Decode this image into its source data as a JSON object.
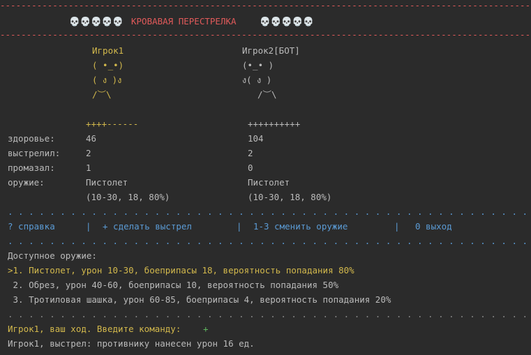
{
  "header": {
    "line_top": "------------------------------------------------------------------------------------------------------------------------",
    "skulls_left": "💀💀💀💀💀",
    "title": "КРОВАВАЯ ПЕРЕСТРЕЛКА",
    "skulls_right": "💀💀💀💀💀",
    "line_bottom": "------------------------------------------------------------------------------------------------------------------------"
  },
  "player1": {
    "name": "Игрок1",
    "art": [
      "( •_•)",
      "( ง )ง",
      "/︶\\"
    ],
    "health_bar": "++++------",
    "health": "46",
    "shots": "2",
    "misses": "1",
    "weapon": "Пистолет",
    "weapon_stats": "(10-30, 18, 80%)"
  },
  "player2": {
    "name": "Игрок2[БОТ]",
    "art": [
      "(•_• )",
      "ง( ง )",
      "/︶\\"
    ],
    "health_bar": "++++++++++",
    "health": "104",
    "shots": "2",
    "misses": "0",
    "weapon": "Пистолет",
    "weapon_stats": "(10-30, 18, 80%)"
  },
  "labels": {
    "health": "здоровье:",
    "shots": "выстрелил:",
    "misses": "промазал:",
    "weapon": "оружие:"
  },
  "menu": {
    "dots": ". . . . . . . . . . . . . . . . . . . . . . . . . . . . . . . . . . . . . . . . . . . . . . . . . . . . . . . . . . . . . . . .",
    "help": "? справка",
    "sep1": "|",
    "shoot": "+ сделать выстрел",
    "sep2": "|",
    "change_weapon": "1-3 сменить оружие",
    "sep3": "|",
    "exit": "0 выход"
  },
  "weapons": {
    "title": "Доступное оружие:",
    "items": [
      ">1. Пистолет, урон 10-30, боеприпасы 18, вероятность попадания 80%",
      " 2. Обрез, урон 40-60, боеприпасы 10, вероятность попадания 50%",
      " 3. Тротиловая шашка, урон 60-85, боеприпасы 4, вероятность попадания 20%"
    ]
  },
  "prompt": {
    "text": "Игрок1, ваш ход. Введите команду:",
    "input": "+",
    "log": "Игрок1, выстрел: противнику нанесен урон 16 ед."
  },
  "colors": {
    "background": "#2b2b2b",
    "red": "#e05a5a",
    "yellow": "#d2b84c",
    "blue": "#5b9bd5",
    "green": "#5fb85f"
  }
}
